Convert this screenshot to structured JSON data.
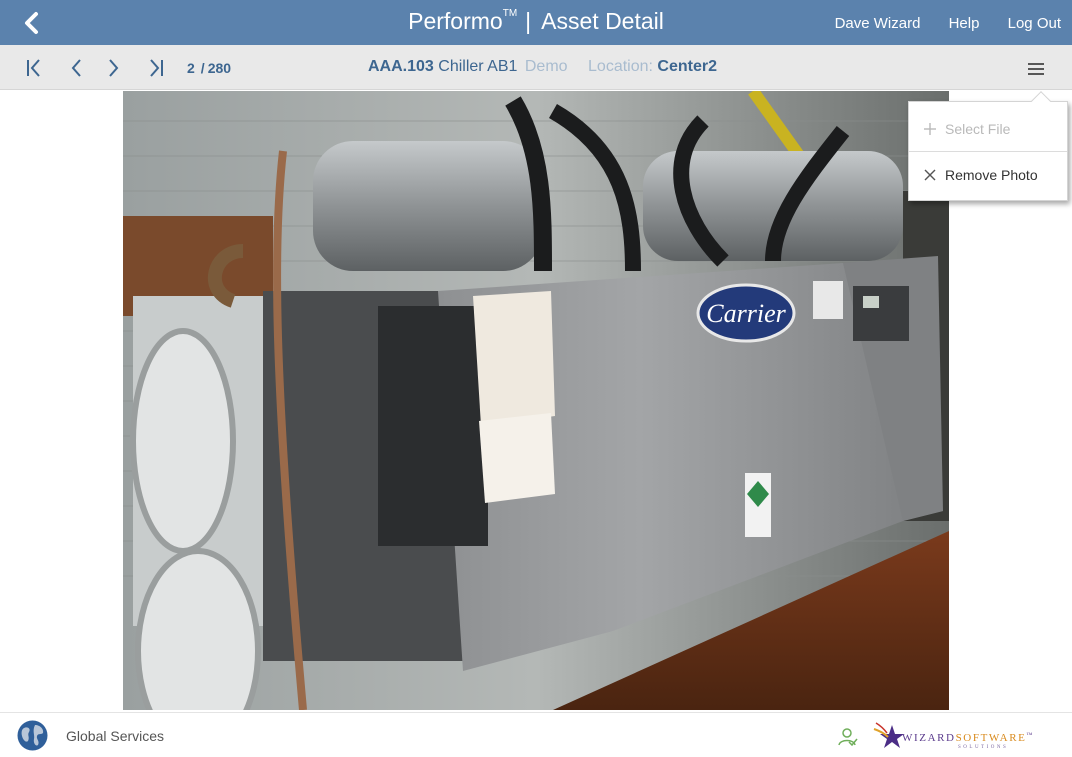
{
  "header": {
    "app_name": "Performo",
    "trademark": "TM",
    "separator": "|",
    "page_title": "Asset Detail",
    "links": [
      "Dave Wizard",
      "Help",
      "Log Out"
    ],
    "bg_color": "#5b82ad"
  },
  "toolbar": {
    "current": "2",
    "total": "280",
    "slash": "/",
    "asset_id": "AAA.103",
    "asset_name": "Chiller AB1",
    "asset_tag": "Demo",
    "location_label": "Location:",
    "location_value": "Center2",
    "icons": [
      "first-page-icon",
      "previous-icon",
      "next-icon",
      "last-page-icon",
      "hamburger-menu-icon"
    ]
  },
  "photo": {
    "subject": "Carrier water-cooled chiller",
    "logo_text": "Carrier"
  },
  "menu": {
    "items": [
      {
        "label": "Select File",
        "icon": "plus-icon",
        "enabled": false
      },
      {
        "label": "Remove Photo",
        "icon": "close-icon",
        "enabled": true
      }
    ]
  },
  "footer": {
    "company": "Global Services",
    "logo_main_a": "WIZARD",
    "logo_main_b": "SOFTWARE",
    "logo_tm": "™",
    "logo_sub": "SOLUTIONS"
  }
}
